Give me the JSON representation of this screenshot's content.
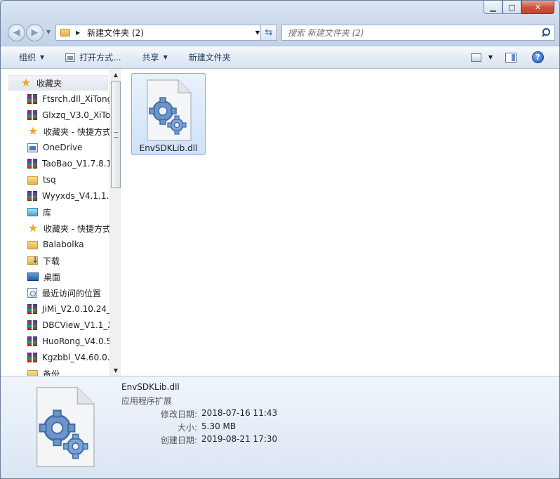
{
  "window": {
    "buttons": {
      "minimize": "▁",
      "maximize": "□",
      "close": "✕"
    }
  },
  "address_bar": {
    "path": "新建文件夹 (2)"
  },
  "search": {
    "placeholder": "搜索 新建文件夹 (2)"
  },
  "toolbar": {
    "organize": "组织",
    "open_with": "打开方式...",
    "share": "共享",
    "new_folder": "新建文件夹",
    "help": "?"
  },
  "sidebar": {
    "items": [
      {
        "label": "收藏夹",
        "icon": "star-icon"
      },
      {
        "label": "Ftsrch.dll_XiTong",
        "icon": "winrar-icon"
      },
      {
        "label": "Glxzq_V3.0_XiTo",
        "icon": "winrar-icon"
      },
      {
        "label": "收藏夹 - 快捷方式",
        "icon": "star-icon"
      },
      {
        "label": "OneDrive",
        "icon": "onedrive-icon"
      },
      {
        "label": "TaoBao_V1.7.8.1",
        "icon": "winrar-icon"
      },
      {
        "label": "tsq",
        "icon": "folder-icon"
      },
      {
        "label": "Wyyxds_V4.1.1.1",
        "icon": "winrar-icon"
      },
      {
        "label": "库",
        "icon": "library-icon"
      },
      {
        "label": "收藏夹 - 快捷方式",
        "icon": "star-icon"
      },
      {
        "label": "Balabolka",
        "icon": "folder-icon"
      },
      {
        "label": "下载",
        "icon": "download-folder-icon"
      },
      {
        "label": "桌面",
        "icon": "desktop-icon"
      },
      {
        "label": "最近访问的位置",
        "icon": "recent-places-icon"
      },
      {
        "label": "JiMi_V2.0.10.24_",
        "icon": "winrar-icon"
      },
      {
        "label": "DBCView_V1.1_X",
        "icon": "winrar-icon"
      },
      {
        "label": "HuoRong_V4.0.5",
        "icon": "winrar-icon"
      },
      {
        "label": "Kgzbbl_V4.60.0.5",
        "icon": "winrar-icon"
      },
      {
        "label": "备份",
        "icon": "folder-icon"
      }
    ]
  },
  "file": {
    "name": "EnvSDKLib.dll",
    "icon": "dll-file-icon"
  },
  "details": {
    "name": "EnvSDKLib.dll",
    "type": "应用程序扩展",
    "modified_label": "修改日期:",
    "modified_value": "2018-07-16 11:43",
    "size_label": "大小:",
    "size_value": "5.30 MB",
    "created_label": "创建日期:",
    "created_value": "2019-08-21 17:30"
  }
}
